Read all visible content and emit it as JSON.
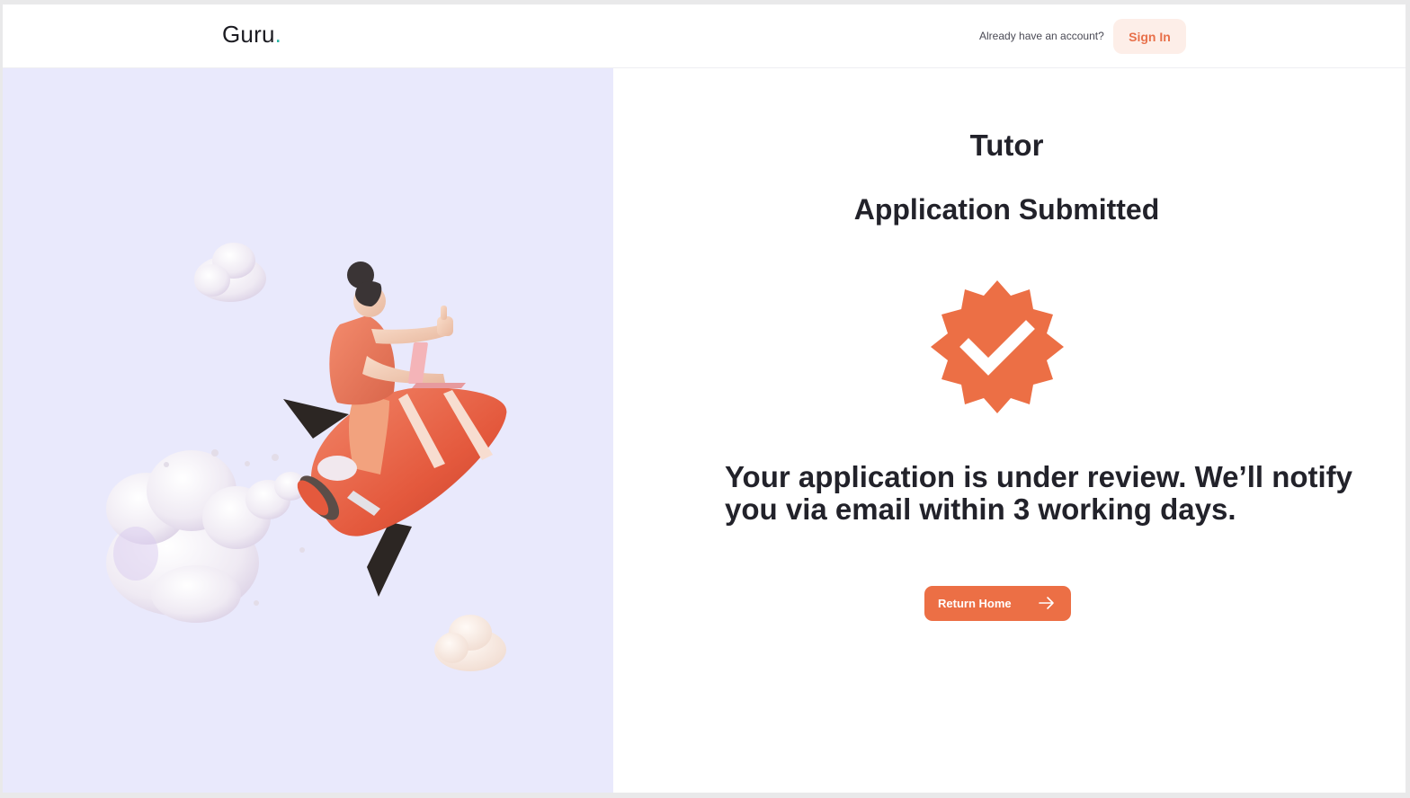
{
  "header": {
    "logo_text": "Guru",
    "logo_dot": ".",
    "account_question": "Already have an account?",
    "signin_label": "Sign In"
  },
  "main": {
    "role_title": "Tutor",
    "status_title": "Application Submitted",
    "badge_icon": "verified-check-badge-icon",
    "message": "Your application is under review. We’ll notify you via email within 3 working days.",
    "return_label": "Return Home",
    "return_icon": "arrow-right-icon"
  },
  "illustration": {
    "subject": "person riding a rocket with a laptop among clouds"
  },
  "colors": {
    "accent": "#ec6f45",
    "accent_soft": "#fdeee8",
    "panel_bg": "#e9e9fc",
    "text_dark": "#22222a",
    "logo_dot": "#2bb6a6"
  }
}
